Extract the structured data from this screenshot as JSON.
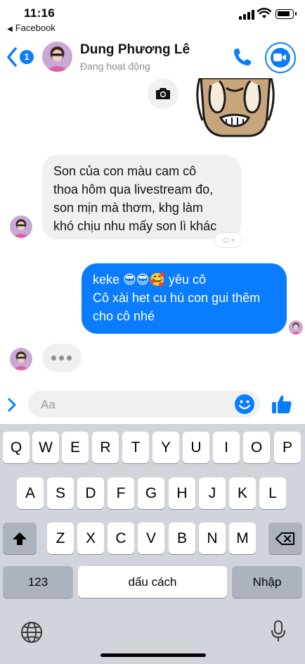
{
  "status_bar": {
    "time": "11:16",
    "back_app": "Facebook"
  },
  "header": {
    "unread_count": "1",
    "contact_name": "Dung Phương Lê",
    "contact_status": "Đang hoạt động"
  },
  "messages": [
    {
      "direction": "incoming",
      "lines": [
        "Son của con màu cam cô",
        "thoa hôm qua livestream đo,",
        "son mịn mà thơm, khg làm",
        "khó chịu nhu mấy son lì khác"
      ]
    },
    {
      "direction": "outgoing",
      "lines": [
        "keke 😎😎🥰 yêu cô",
        "Cô xài het cu hú con gui thêm",
        "cho cô nhé"
      ]
    }
  ],
  "composer": {
    "placeholder": "Aa"
  },
  "keyboard": {
    "row1": [
      "Q",
      "W",
      "E",
      "R",
      "T",
      "Y",
      "U",
      "I",
      "O",
      "P"
    ],
    "row2": [
      "A",
      "S",
      "D",
      "F",
      "G",
      "H",
      "J",
      "K",
      "L"
    ],
    "row3": [
      "Z",
      "X",
      "C",
      "V",
      "B",
      "N",
      "M"
    ],
    "numbers_key": "123",
    "space_key": "dấu cách",
    "return_key": "Nhập"
  },
  "colors": {
    "accent": "#0a7cff",
    "incoming_bubble": "#f0f0f0",
    "keyboard_bg": "#d1d4db",
    "dark_key": "#adb3bd"
  },
  "icons": {
    "back": "chevron-left-icon",
    "call": "phone-icon",
    "video": "video-camera-icon",
    "camera": "camera-icon",
    "emoji": "smiley-icon",
    "like": "thumbs-up-icon",
    "shift": "shift-arrow-icon",
    "delete": "backspace-icon",
    "globe": "globe-icon",
    "mic": "microphone-icon"
  }
}
